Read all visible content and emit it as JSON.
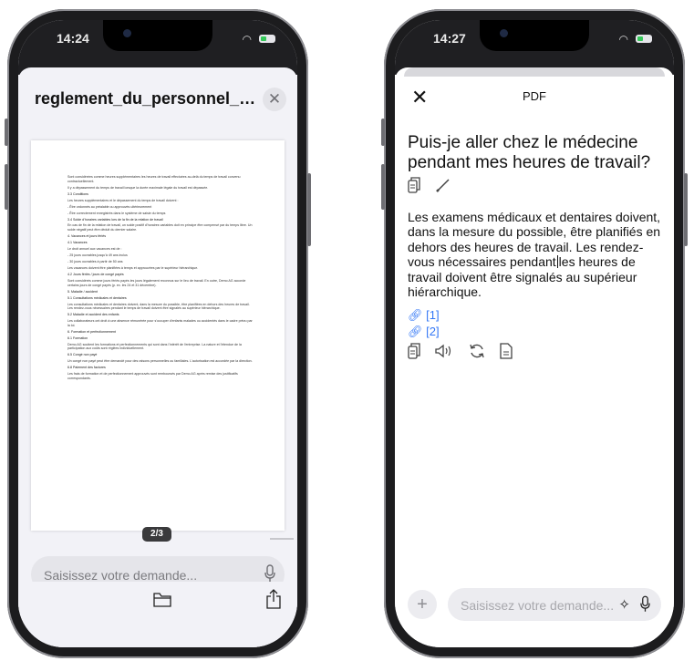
{
  "left": {
    "status": {
      "time": "14:24"
    },
    "document_title": "reglement_du_personnel_demo_ag_f...",
    "close_label": "✕",
    "doc_lines": [
      {
        "text": "Sont considérées comme heures supplémentaires les heures de travail effectuées au-delà du temps de travail convenu contractuellement.",
        "head": false
      },
      {
        "text": "Il y a dépassement du temps de travail lorsque la durée maximale légale du travail est dépassée.",
        "head": false
      },
      {
        "text": "3.3 Conditions",
        "head": true
      },
      {
        "text": "Les heures supplémentaires et le dépassement du temps de travail doivent :",
        "head": false
      },
      {
        "text": "- Être ordonnés au préalable ou approuvés ultérieurement",
        "head": false
      },
      {
        "text": "- Être correctement enregistrés dans le système de saisie du temps",
        "head": false
      },
      {
        "text": "3.4 Solde d'horaires variables lors de la fin de la relation de travail",
        "head": true
      },
      {
        "text": "En cas de fin de la relation de travail, un solde positif d'horaires variables doit en principe être compensé par du temps libre. Un solde négatif peut être déduit du dernier salaire.",
        "head": false
      },
      {
        "text": "4. Vacances et jours fériés",
        "head": true
      },
      {
        "text": "4.1 Vacances",
        "head": true
      },
      {
        "text": "Le droit annuel aux vacances est de :",
        "head": false
      },
      {
        "text": "- 25 jours ouvrables jusqu'à 49 ans inclus",
        "head": false
      },
      {
        "text": "- 30 jours ouvrables à partir de 50 ans",
        "head": false
      },
      {
        "text": "Les vacances doivent être planifiées à temps et approuvées par le supérieur hiérarchique.",
        "head": false
      },
      {
        "text": "4.2 Jours fériés / jours de congé payés",
        "head": true
      },
      {
        "text": "Sont considérés comme jours fériés payés les jours légalement reconnus sur le lieu de travail. En outre, Demo AG accorde certains jours de congé payés (p. ex. les 24 et 31 décembre).",
        "head": false
      },
      {
        "text": "5. Maladie / accident",
        "head": true
      },
      {
        "text": "5.1 Consultations médicales et dentaires",
        "head": true
      },
      {
        "text": "Les consultations médicales et dentaires doivent, dans la mesure du possible, être planifiées en dehors des heures de travail. Les rendez-vous nécessaires pendant le temps de travail doivent être signalés au supérieur hiérarchique.",
        "head": false
      },
      {
        "text": "5.2 Maladie et accident des enfants",
        "head": true
      },
      {
        "text": "Les collaborateurs ont droit à une absence rémunérée pour s'occuper d'enfants malades ou accidentés dans le cadre prévu par la loi.",
        "head": false
      },
      {
        "text": "6. Formation et perfectionnement",
        "head": true
      },
      {
        "text": "6.1 Formation",
        "head": true
      },
      {
        "text": "Demo AG soutient les formations et perfectionnements qui sont dans l'intérêt de l'entreprise. La nature et l'étendue de la participation aux coûts sont réglées individuellement.",
        "head": false
      },
      {
        "text": "6.5 Congé non payé",
        "head": true
      },
      {
        "text": "Un congé non payé peut être demandé pour des raisons personnelles ou familiales. L'autorisation est accordée par la direction.",
        "head": false
      },
      {
        "text": "6.8 Paiement des factures",
        "head": true
      },
      {
        "text": "Les frais de formation et de perfectionnement approuvés sont remboursés par Demo AG après remise des justificatifs correspondants.",
        "head": false
      }
    ],
    "page_indicator": "2/3",
    "input_placeholder": "Saisissez votre demande..."
  },
  "right": {
    "status": {
      "time": "14:27"
    },
    "close_label": "✕",
    "header_title": "PDF",
    "question": "Puis-je aller chez le médecine pendant mes heures de travail?",
    "answer_before_cursor": "Les examens médicaux et dentaires doivent, dans la mesure du possible, être planifiés en dehors des heures de travail. Les rendez-vous nécessaires pendant",
    "answer_after_cursor": "les heures de travail doivent être signalés au supérieur hiérarchique.",
    "references": [
      "[1]",
      "[2]"
    ],
    "plus_label": "+",
    "input_placeholder": "Saisissez votre demande..."
  },
  "colors": {
    "link": "#3478f6",
    "frame": "#1c1c1e",
    "battery": "#34c759"
  }
}
